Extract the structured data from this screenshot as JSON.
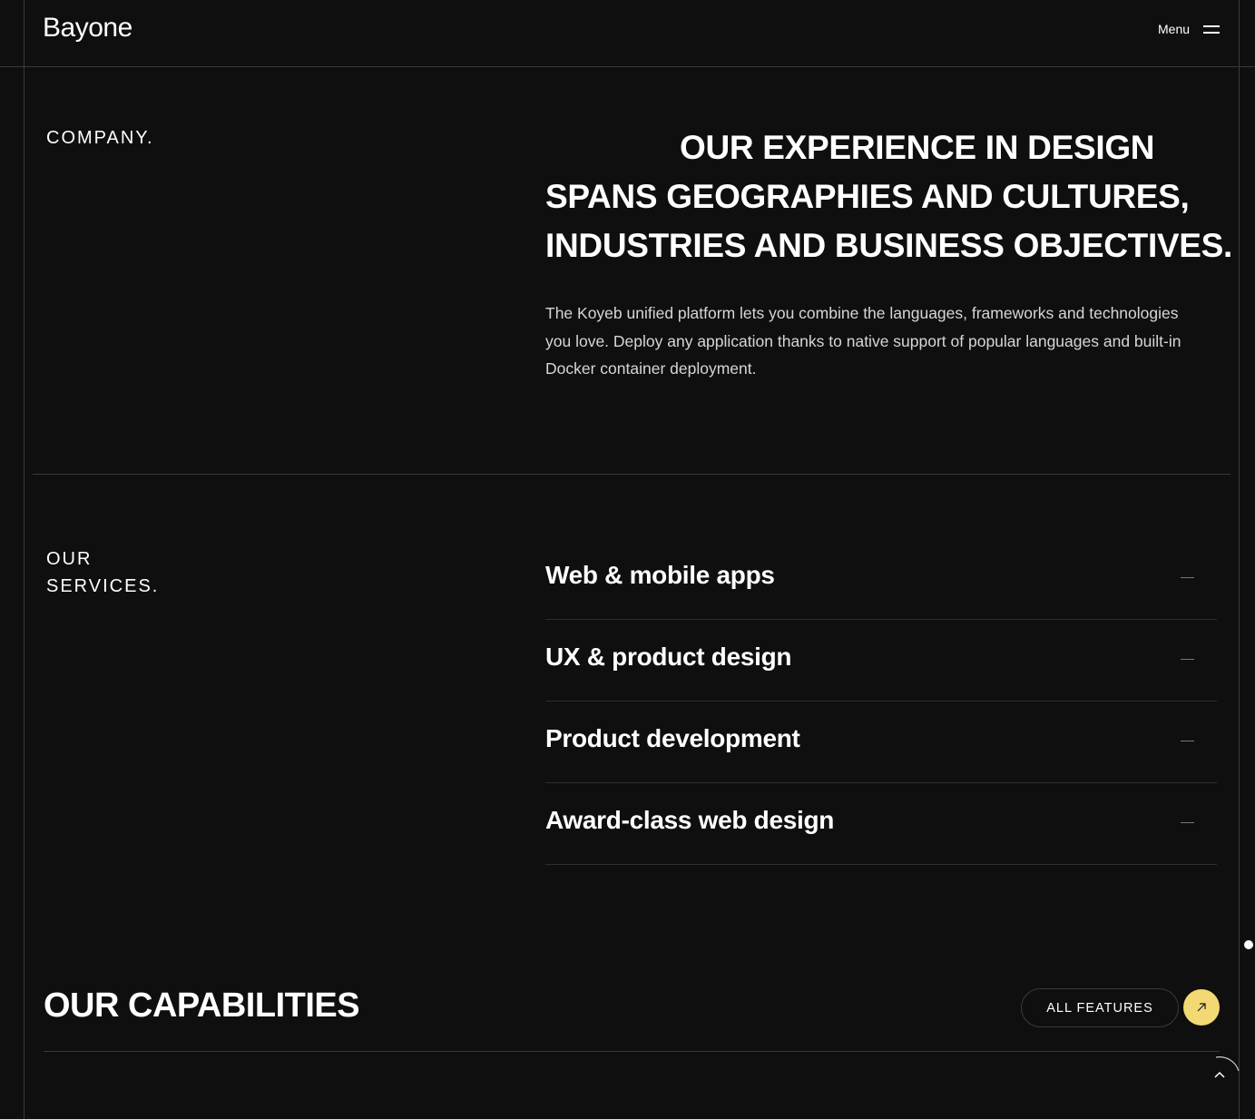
{
  "header": {
    "logo": "Bayone",
    "menu_label": "Menu"
  },
  "company": {
    "label": "COMPANY.",
    "headline_line1": "OUR EXPERIENCE IN DESIGN",
    "headline_line2": "SPANS GEOGRAPHIES AND CULTURES,",
    "headline_line3": "INDUSTRIES AND BUSINESS OBJECTIVES.",
    "description": "The Koyeb unified platform lets you combine the languages, frameworks and technologies you love. Deploy any application thanks to native support of popular languages and built-in Docker container deployment."
  },
  "services": {
    "label_line1": "OUR",
    "label_line2": "SERVICES.",
    "items": [
      {
        "title": "Web & mobile apps"
      },
      {
        "title": "UX & product design"
      },
      {
        "title": "Product development"
      },
      {
        "title": "Award-class web design"
      }
    ]
  },
  "capabilities": {
    "title": "OUR CAPABILITIES",
    "button_label": "ALL FEATURES"
  },
  "colors": {
    "background": "#0f0f0f",
    "accent": "#f2d974",
    "divider": "#3a3a3a"
  },
  "icons": {
    "menu": "hamburger-icon",
    "arrow": "arrow-up-right-icon",
    "back_to_top": "chevron-up-icon",
    "toggle": "minus-icon"
  }
}
